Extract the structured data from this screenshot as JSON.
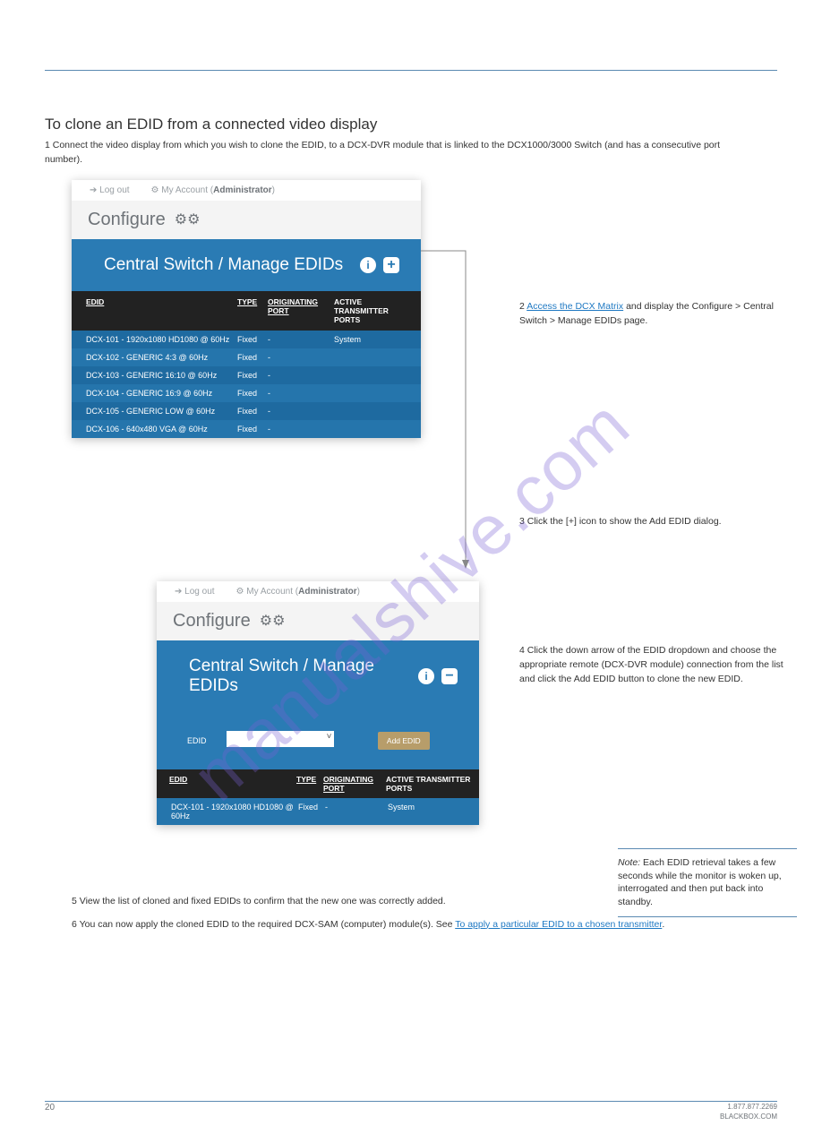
{
  "section_title": "To clone an EDID from a connected video display",
  "section_intro": "1  Connect the video display from which you wish to clone the EDID, to a DCX-DVR module that is linked to the DCX1000/3000 Switch (and has a consecutive port number).",
  "steps": {
    "s2_pre": "2  ",
    "s2_link": "Access the DCX Matrix",
    "s2_post": " and display the Configure > Central Switch > Manage EDIDs page.",
    "s3": "3  Click the [+] icon to show the Add EDID dialog.",
    "s4": "4  Click the down arrow of the EDID dropdown and choose the appropriate remote (DCX-DVR module) connection from the list and click the Add EDID button to clone the new EDID.",
    "s5": "5  View the list of cloned and fixed EDIDs to confirm that the new one was correctly added.",
    "s6_pre": "6  You can now apply the cloned EDID to the required DCX-SAM (computer) module(s). See ",
    "s6_link": "To apply a particular EDID to a chosen transmitter",
    "s6_post": "."
  },
  "note": {
    "label": "Note:",
    "body": " Each EDID retrieval takes a few seconds while the monitor is woken up, interrogated and then put back into standby."
  },
  "ui": {
    "logout": "Log out",
    "myaccount": "My Account",
    "role": "Administrator",
    "configure": "Configure",
    "page_title": "Central Switch / Manage EDIDs",
    "edid_label": "EDID",
    "add_btn": "Add EDID",
    "cols": [
      "EDID",
      "TYPE",
      "ORIGINATING PORT",
      "ACTIVE TRANSMITTER PORTS"
    ],
    "rows": [
      [
        "DCX-101 - 1920x1080 HD1080 @ 60Hz",
        "Fixed",
        "-",
        "System"
      ],
      [
        "DCX-102 - GENERIC 4:3 @ 60Hz",
        "Fixed",
        "-",
        ""
      ],
      [
        "DCX-103 - GENERIC 16:10 @ 60Hz",
        "Fixed",
        "-",
        ""
      ],
      [
        "DCX-104 - GENERIC 16:9 @ 60Hz",
        "Fixed",
        "-",
        ""
      ],
      [
        "DCX-105 - GENERIC LOW @ 60Hz",
        "Fixed",
        "-",
        ""
      ],
      [
        "DCX-106 - 640x480 VGA @ 60Hz",
        "Fixed",
        "-",
        ""
      ]
    ]
  },
  "watermark": "manualshive.com",
  "footer": {
    "page": "20",
    "phone": "1.877.877.2269",
    "email": "BLACKBOX.COM"
  }
}
